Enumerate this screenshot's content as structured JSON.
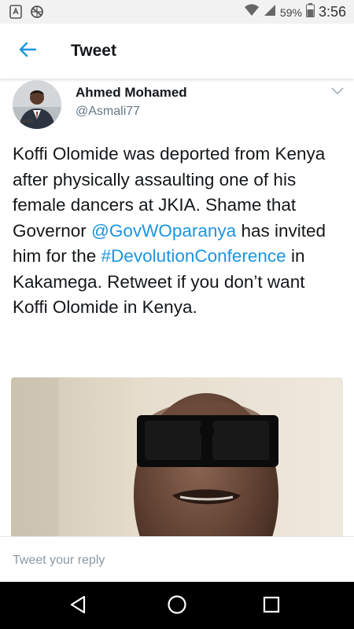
{
  "status_bar": {
    "battery_percent": "59%",
    "time": "3:56",
    "icons": [
      "screenshot-icon",
      "data-saver-icon",
      "wifi-icon",
      "signal-icon",
      "battery-icon"
    ]
  },
  "app_bar": {
    "title": "Tweet",
    "back_icon": "arrow-left-icon"
  },
  "tweet": {
    "author_name": "Ahmed Mohamed",
    "author_handle": "@Asmali77",
    "text_parts": {
      "p1": "Koffi Olomide was deported from Kenya after physically assaulting one of his female dancers at JKIA. Shame that Governor ",
      "mention": "@GovWOparanya",
      "p2": " has invited him for the ",
      "hashtag": "#DevolutionConference",
      "p3": " in Kakamega. Retweet if you don’t want Koffi Olomide in Kenya."
    }
  },
  "reply": {
    "placeholder": "Tweet your reply"
  },
  "nav": {
    "icons": [
      "back-triangle-icon",
      "home-icon",
      "recents-icon"
    ]
  },
  "colors": {
    "accent": "#1b95e0",
    "text": "#14171a",
    "secondary": "#657786",
    "status_bar": "#f2f2f2",
    "nav_bar": "#000000"
  }
}
